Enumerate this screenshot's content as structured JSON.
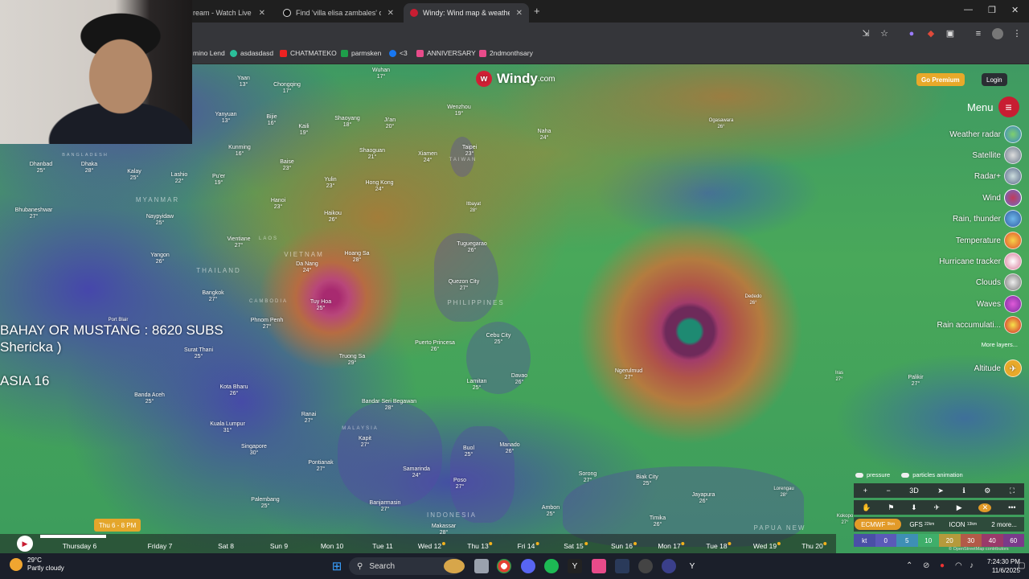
{
  "tabs": [
    {
      "label": "ream - Watch Live on",
      "active": false
    },
    {
      "label": "Find 'villa elisa zambales' on Tik",
      "active": false
    },
    {
      "label": "Windy: Wind map & weather fo",
      "active": true
    }
  ],
  "bookmarks": [
    {
      "label": "mino Lend"
    },
    {
      "label": "asdasdasd"
    },
    {
      "label": "CHATMATEKO"
    },
    {
      "label": "parmsken"
    },
    {
      "label": "<3"
    },
    {
      "label": "ANNIVERSARY"
    },
    {
      "label": "2ndmonthsary"
    }
  ],
  "windy": {
    "logo": "Windy",
    "logo_suffix": ".com",
    "premium_label": "Go Premium",
    "login_label": "Login",
    "menu_label": "Menu",
    "layers": [
      {
        "label": "Weather radar"
      },
      {
        "label": "Satellite"
      },
      {
        "label": "Radar+"
      },
      {
        "label": "Wind"
      },
      {
        "label": "Rain, thunder"
      },
      {
        "label": "Temperature"
      },
      {
        "label": "Hurricane tracker"
      },
      {
        "label": "Clouds"
      },
      {
        "label": "Waves"
      },
      {
        "label": "Rain accumulati..."
      }
    ],
    "more_layers": "More layers...",
    "altitude_label": "Altitude",
    "toggles": {
      "pressure": "pressure",
      "particles": "particles animation"
    },
    "controls": {
      "zoom_in": "+",
      "zoom_out": "−",
      "three_d": "3D"
    },
    "models": [
      {
        "label": "ECMWF",
        "sub": "9km",
        "active": true
      },
      {
        "label": "GFS",
        "sub": "22km",
        "active": false
      },
      {
        "label": "ICON",
        "sub": "13km",
        "active": false
      },
      {
        "label": "2 more...",
        "sub": "",
        "active": false
      }
    ],
    "scale": {
      "unit": "kt",
      "ticks": [
        "0",
        "5",
        "10",
        "20",
        "30",
        "40",
        "60"
      ]
    },
    "attribution": "© OpenStreetMap contributors"
  },
  "overlay": {
    "line1": "BAHAY OR MUSTANG : 8620 SUBS",
    "line2": "Shericka )",
    "line3": "ASIA 16"
  },
  "countries": [
    "MYANMAR",
    "THAILAND",
    "CAMBODIA",
    "VIETNAM",
    "PHILIPPINES",
    "MALAYSIA",
    "INDONESIA",
    "PAPUA NEW",
    "BANGLADESH",
    "LAOS",
    "TAIWAN"
  ],
  "cities": [
    {
      "name": "Yaan",
      "t": "13°"
    },
    {
      "name": "Chongqing",
      "t": "17°"
    },
    {
      "name": "Wuhan",
      "t": "17°"
    },
    {
      "name": "Yanyuan",
      "t": "13°"
    },
    {
      "name": "Bijie",
      "t": "16°"
    },
    {
      "name": "Kaili",
      "t": "19°"
    },
    {
      "name": "Shaoyang",
      "t": "18°"
    },
    {
      "name": "Ji'an",
      "t": "20°"
    },
    {
      "name": "Wenzhou",
      "t": "19°"
    },
    {
      "name": "Naha",
      "t": "24°"
    },
    {
      "name": "Ogasawara",
      "t": "26°"
    },
    {
      "name": "Kunming",
      "t": "16°"
    },
    {
      "name": "Shaoguan",
      "t": "21°"
    },
    {
      "name": "Xiamen",
      "t": "24°"
    },
    {
      "name": "Taipei",
      "t": "23°"
    },
    {
      "name": "Dhanbad",
      "t": "25°"
    },
    {
      "name": "Dhaka",
      "t": "28°"
    },
    {
      "name": "Kalay",
      "t": "25°"
    },
    {
      "name": "Lashio",
      "t": "22°"
    },
    {
      "name": "Pu'er",
      "t": "19°"
    },
    {
      "name": "Baise",
      "t": "23°"
    },
    {
      "name": "Yulin",
      "t": "23°"
    },
    {
      "name": "Hong Kong",
      "t": "24°"
    },
    {
      "name": "Hanoi",
      "t": "23°"
    },
    {
      "name": "Haikou",
      "t": "26°"
    },
    {
      "name": "Itbayat",
      "t": "28°"
    },
    {
      "name": "Bhubaneshwar",
      "t": "27°"
    },
    {
      "name": "Naypyidaw",
      "t": "25°"
    },
    {
      "name": "Vientiane",
      "t": "27°"
    },
    {
      "name": "Da Nang",
      "t": "24°"
    },
    {
      "name": "Hoang Sa",
      "t": "28°"
    },
    {
      "name": "Tuguegarao",
      "t": "26°"
    },
    {
      "name": "Yangon",
      "t": "26°"
    },
    {
      "name": "Quezon City",
      "t": "27°"
    },
    {
      "name": "Dededo",
      "t": "26°"
    },
    {
      "name": "Bangkok",
      "t": "27°"
    },
    {
      "name": "Tuy Hoa",
      "t": "25°"
    },
    {
      "name": "Phnom Penh",
      "t": "27°"
    },
    {
      "name": "Cebu City",
      "t": "25°"
    },
    {
      "name": "Puerto Princesa",
      "t": "26°"
    },
    {
      "name": "Surat Thani",
      "t": "25°"
    },
    {
      "name": "Truong Sa",
      "t": "29°"
    },
    {
      "name": "Davao",
      "t": "26°"
    },
    {
      "name": "Ngerulmud",
      "t": "27°"
    },
    {
      "name": "Lamitan",
      "t": "25°"
    },
    {
      "name": "Banda Aceh",
      "t": "25°"
    },
    {
      "name": "Kota Bharu",
      "t": "26°"
    },
    {
      "name": "Bandar Seri Begawan",
      "t": "28°"
    },
    {
      "name": "Palikir",
      "t": "27°"
    },
    {
      "name": "Kuala Lumpur",
      "t": "31°"
    },
    {
      "name": "Ranai",
      "t": "27°"
    },
    {
      "name": "Kapit",
      "t": "27°"
    },
    {
      "name": "Singapore",
      "t": "30°"
    },
    {
      "name": "Pontianak",
      "t": "27°"
    },
    {
      "name": "Buol",
      "t": "25°"
    },
    {
      "name": "Manado",
      "t": "26°"
    },
    {
      "name": "Samarinda",
      "t": "24°"
    },
    {
      "name": "Sorong",
      "t": "27°"
    },
    {
      "name": "Biak City",
      "t": "25°"
    },
    {
      "name": "Jayapura",
      "t": "26°"
    },
    {
      "name": "Poso",
      "t": "27°"
    },
    {
      "name": "Palembang",
      "t": "25°"
    },
    {
      "name": "Banjarmasin",
      "t": "27°"
    },
    {
      "name": "Ambon",
      "t": "25°"
    },
    {
      "name": "Timika",
      "t": "26°"
    },
    {
      "name": "Makassar",
      "t": "28°"
    },
    {
      "name": "Lorengau",
      "t": "28°"
    },
    {
      "name": "Kokopo",
      "t": "27°"
    },
    {
      "name": "Port Blair",
      "t": ""
    },
    {
      "name": "Iras",
      "t": "27°"
    }
  ],
  "timeline": {
    "current": "Thu 6 - 8 PM",
    "days": [
      {
        "label": "Thursday 6",
        "dot": false
      },
      {
        "label": "Friday 7",
        "dot": false
      },
      {
        "label": "Sat 8",
        "dot": false
      },
      {
        "label": "Sun 9",
        "dot": false
      },
      {
        "label": "Mon 10",
        "dot": false
      },
      {
        "label": "Tue 11",
        "dot": false
      },
      {
        "label": "Wed 12",
        "dot": true
      },
      {
        "label": "Thu 13",
        "dot": true
      },
      {
        "label": "Fri 14",
        "dot": true
      },
      {
        "label": "Sat 15",
        "dot": true
      },
      {
        "label": "Sun 16",
        "dot": true
      },
      {
        "label": "Mon 17",
        "dot": true
      },
      {
        "label": "Tue 18",
        "dot": true
      },
      {
        "label": "Wed 19",
        "dot": true
      },
      {
        "label": "Thu 20",
        "dot": true
      }
    ]
  },
  "taskbar": {
    "temp": "29°C",
    "condition": "Partly cloudy",
    "search_placeholder": "Search",
    "time": "7:24:30 PM",
    "date": "11/6/2025"
  }
}
